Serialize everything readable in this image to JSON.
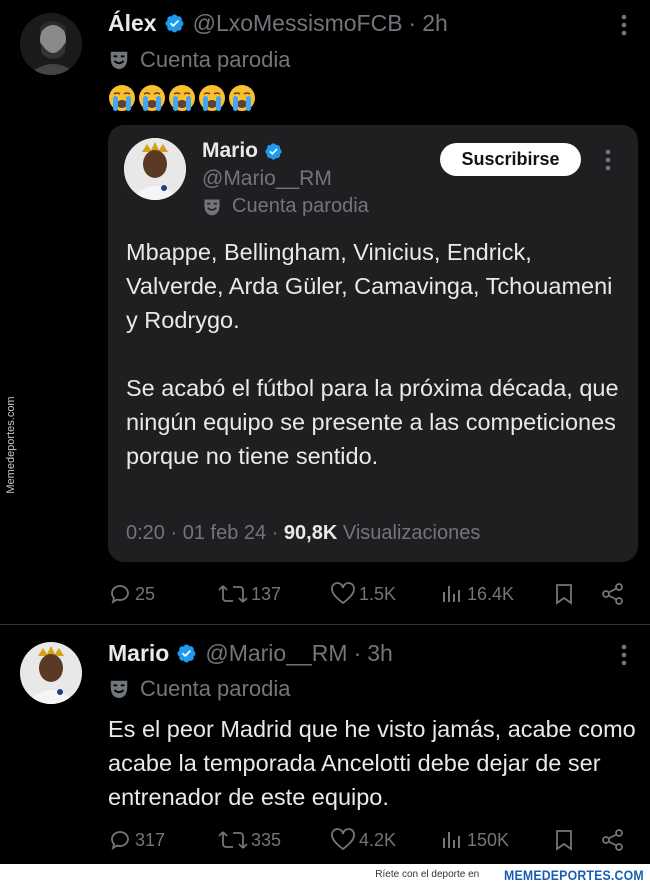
{
  "watermark": {
    "side_text": "Memedeportes.com",
    "footer_tagline": "Ríete con el deporte en",
    "footer_logo": "MEMEDEPORTES.COM"
  },
  "colors": {
    "background": "#000000",
    "verified": "#1d9bf0",
    "muted": "#71767b",
    "quote_bg": "#1f1f21"
  },
  "tweet1": {
    "name": "Álex",
    "handle": "@LxoMessismoFCB",
    "separator": "·",
    "time": "2h",
    "parody_label": "Cuenta parodia",
    "emojis": [
      "😭",
      "😭",
      "😭",
      "😭",
      "😭"
    ],
    "quote": {
      "name": "Mario",
      "handle": "@Mario__RM",
      "parody_label": "Cuenta parodia",
      "subscribe_label": "Suscribirse",
      "paragraph1": "Mbappe, Bellingham, Vinicius, Endrick, Valverde, Arda Güler, Camavinga, Tchouameni y Rodrygo.",
      "paragraph2": "Se acabó el fútbol para la próxima década, que ningún equipo se presente a las competiciones porque no tiene sentido.",
      "time": "0:20",
      "date": "01 feb 24",
      "views_count": "90,8K",
      "views_label": "Visualizaciones"
    },
    "actions": {
      "replies": "25",
      "reposts": "137",
      "likes": "1.5K",
      "views": "16.4K"
    }
  },
  "tweet2": {
    "name": "Mario",
    "handle": "@Mario__RM",
    "separator": "·",
    "time": "3h",
    "parody_label": "Cuenta parodia",
    "text": "Es el peor Madrid que he visto jamás, acabe como acabe la temporada Ancelotti debe dejar de ser entrenador de este equipo.",
    "actions": {
      "replies": "317",
      "reposts": "335",
      "likes": "4.2K",
      "views": "150K"
    }
  }
}
